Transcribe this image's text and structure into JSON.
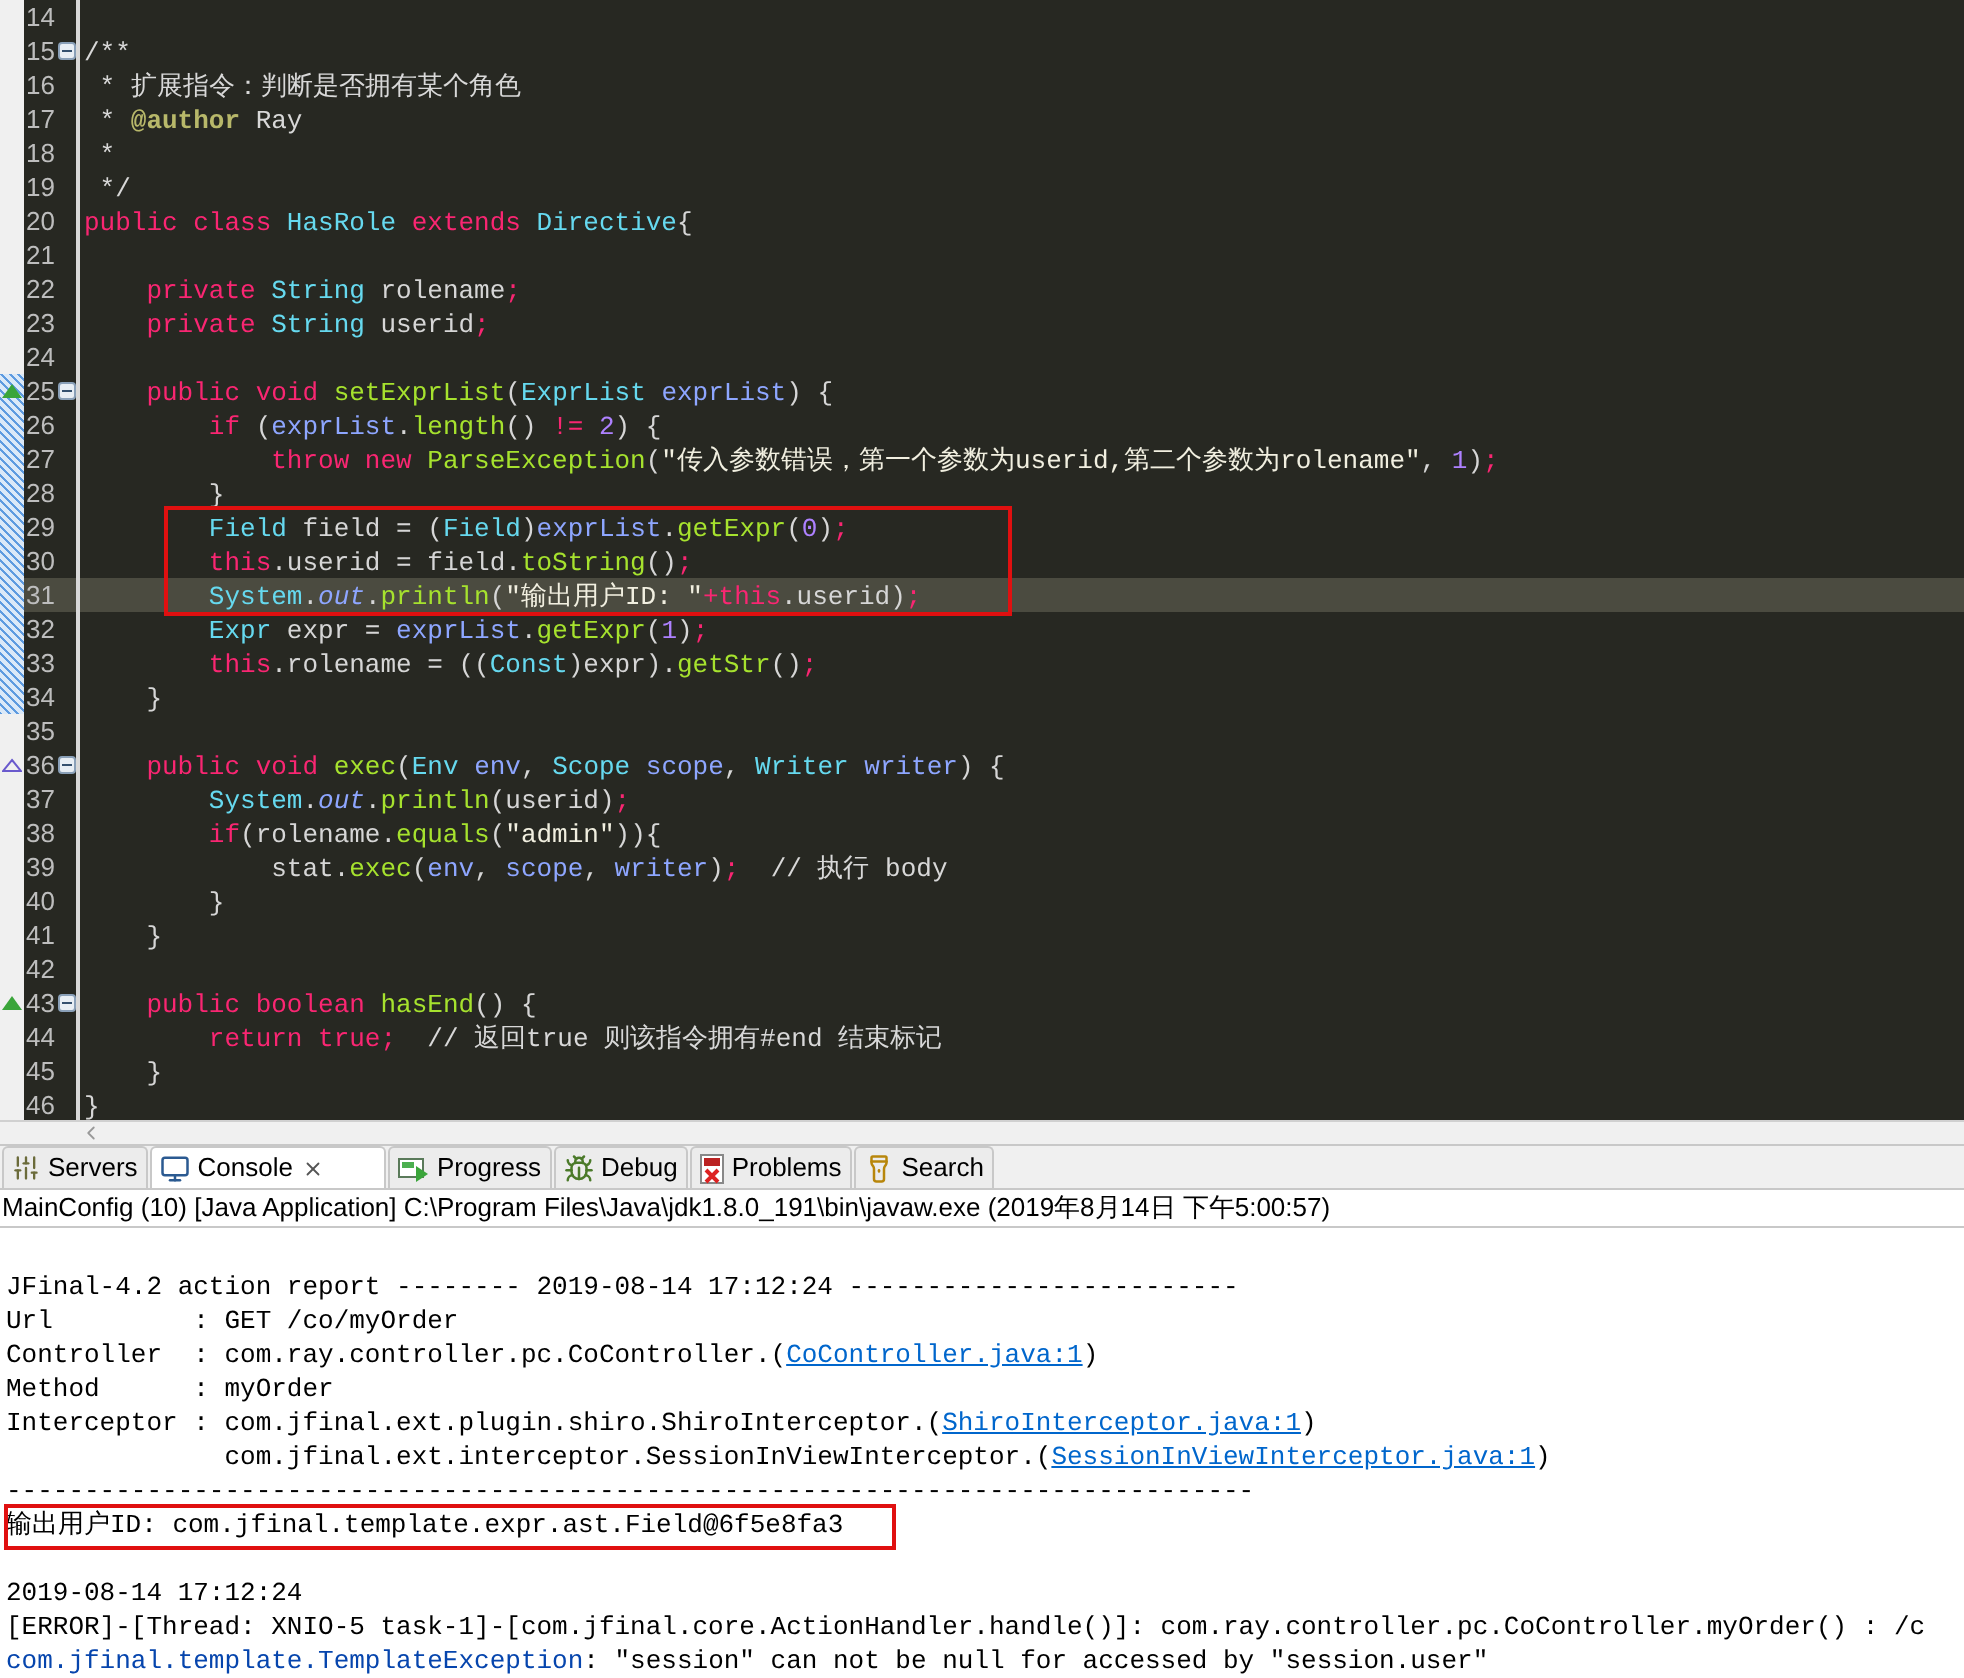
{
  "editor": {
    "lines": [
      {
        "number": "14",
        "current": false,
        "boxed": false,
        "marked": false,
        "fold": false
      },
      {
        "number": "15",
        "tokens": [
          {
            "kind": "comment",
            "text": "/**"
          }
        ],
        "current": false,
        "boxed": false,
        "marked": false,
        "fold": true
      },
      {
        "number": "16",
        "tokens": [
          {
            "kind": "comment",
            "text": " * 扩展指令：判断是否拥有某个角色"
          }
        ],
        "current": false,
        "boxed": false,
        "marked": false,
        "fold": false
      },
      {
        "number": "17",
        "tokens": [
          {
            "kind": "comment",
            "text": " * "
          },
          {
            "kind": "tag",
            "text": "@author"
          },
          {
            "kind": "comment",
            "text": " Ray"
          }
        ],
        "current": false,
        "boxed": false,
        "marked": false,
        "fold": false
      },
      {
        "number": "18",
        "tokens": [
          {
            "kind": "comment",
            "text": " *"
          }
        ],
        "current": false,
        "boxed": false,
        "marked": false,
        "fold": false
      },
      {
        "number": "19",
        "tokens": [
          {
            "kind": "comment",
            "text": " */"
          }
        ],
        "current": false,
        "boxed": false,
        "marked": false,
        "fold": false
      },
      {
        "number": "20",
        "tokens": [
          {
            "kind": "keyword",
            "text": "public class "
          },
          {
            "kind": "type",
            "text": "HasRole "
          },
          {
            "kind": "keyword",
            "text": "extends "
          },
          {
            "kind": "type",
            "text": "Directive"
          },
          {
            "kind": "plain",
            "text": "{"
          }
        ],
        "current": false,
        "boxed": false,
        "marked": false,
        "fold": false
      },
      {
        "number": "21",
        "current": false,
        "boxed": false,
        "marked": false,
        "fold": false
      },
      {
        "number": "22",
        "tokens": [
          {
            "kind": "keyword",
            "text": "    private "
          },
          {
            "kind": "type",
            "text": "String "
          },
          {
            "kind": "plain",
            "text": "rolename"
          },
          {
            "kind": "punct",
            "text": ";"
          }
        ],
        "current": false,
        "boxed": false,
        "marked": false,
        "fold": false
      },
      {
        "number": "23",
        "tokens": [
          {
            "kind": "keyword",
            "text": "    private "
          },
          {
            "kind": "type",
            "text": "String "
          },
          {
            "kind": "plain",
            "text": "userid"
          },
          {
            "kind": "punct",
            "text": ";"
          }
        ],
        "current": false,
        "boxed": false,
        "marked": false,
        "fold": false
      },
      {
        "number": "24",
        "current": false,
        "boxed": false,
        "marked": false,
        "fold": false
      },
      {
        "number": "25",
        "kind": "override",
        "tokens": [
          {
            "kind": "keyword",
            "text": "    public void "
          },
          {
            "kind": "method",
            "text": "setExprList"
          },
          {
            "kind": "plain",
            "text": "("
          },
          {
            "kind": "type",
            "text": "ExprList "
          },
          {
            "kind": "var",
            "text": "exprList"
          },
          {
            "kind": "plain",
            "text": ") {"
          }
        ],
        "current": false,
        "boxed": false,
        "marked": true,
        "fold": true
      },
      {
        "number": "26",
        "tokens": [
          {
            "kind": "keyword",
            "text": "        if"
          },
          {
            "kind": "plain",
            "text": " ("
          },
          {
            "kind": "var",
            "text": "exprList"
          },
          {
            "kind": "plain",
            "text": "."
          },
          {
            "kind": "method",
            "text": "length"
          },
          {
            "kind": "plain",
            "text": "() "
          },
          {
            "kind": "keyword",
            "text": "!= "
          },
          {
            "kind": "number",
            "text": "2"
          },
          {
            "kind": "plain",
            "text": ") {"
          }
        ],
        "current": false,
        "boxed": false,
        "marked": true,
        "fold": false
      },
      {
        "number": "27",
        "tokens": [
          {
            "kind": "keyword",
            "text": "            throw new "
          },
          {
            "kind": "method",
            "text": "ParseException"
          },
          {
            "kind": "plain",
            "text": "("
          },
          {
            "kind": "string",
            "text": "\"传入参数错误，第一个参数为userid,第二个参数为rolename\""
          },
          {
            "kind": "plain",
            "text": ", "
          },
          {
            "kind": "number",
            "text": "1"
          },
          {
            "kind": "plain",
            "text": ")"
          },
          {
            "kind": "punct",
            "text": ";"
          }
        ],
        "current": false,
        "boxed": false,
        "marked": true,
        "fold": false
      },
      {
        "number": "28",
        "tokens": [
          {
            "kind": "plain",
            "text": "        }"
          }
        ],
        "current": false,
        "boxed": false,
        "marked": true,
        "fold": false
      },
      {
        "number": "29",
        "tokens": [
          {
            "kind": "type",
            "text": "        Field"
          },
          {
            "kind": "plain",
            "text": " field = ("
          },
          {
            "kind": "type",
            "text": "Field"
          },
          {
            "kind": "plain",
            "text": ")"
          },
          {
            "kind": "var",
            "text": "exprList"
          },
          {
            "kind": "plain",
            "text": "."
          },
          {
            "kind": "method",
            "text": "getExpr"
          },
          {
            "kind": "plain",
            "text": "("
          },
          {
            "kind": "number",
            "text": "0"
          },
          {
            "kind": "plain",
            "text": ")"
          },
          {
            "kind": "punct",
            "text": ";"
          }
        ],
        "current": false,
        "boxed": true,
        "marked": true,
        "fold": false
      },
      {
        "number": "30",
        "tokens": [
          {
            "kind": "keyword",
            "text": "        this"
          },
          {
            "kind": "plain",
            "text": ".userid = field."
          },
          {
            "kind": "method",
            "text": "toString"
          },
          {
            "kind": "plain",
            "text": "()"
          },
          {
            "kind": "punct",
            "text": ";"
          }
        ],
        "current": false,
        "boxed": true,
        "marked": true,
        "fold": false
      },
      {
        "number": "31",
        "tokens": [
          {
            "kind": "type",
            "text": "        System"
          },
          {
            "kind": "plain",
            "text": "."
          },
          {
            "kind": "static",
            "text": "out"
          },
          {
            "kind": "plain",
            "text": "."
          },
          {
            "kind": "method",
            "text": "println"
          },
          {
            "kind": "plain",
            "text": "("
          },
          {
            "kind": "string",
            "text": "\"输出用户ID: \""
          },
          {
            "kind": "keyword",
            "text": "+this"
          },
          {
            "kind": "plain",
            "text": ".userid)"
          },
          {
            "kind": "punct",
            "text": ";"
          }
        ],
        "current": true,
        "boxed": true,
        "marked": true,
        "fold": false
      },
      {
        "number": "32",
        "tokens": [
          {
            "kind": "type",
            "text": "        Expr"
          },
          {
            "kind": "plain",
            "text": " expr = "
          },
          {
            "kind": "var",
            "text": "exprList"
          },
          {
            "kind": "plain",
            "text": "."
          },
          {
            "kind": "method",
            "text": "getExpr"
          },
          {
            "kind": "plain",
            "text": "("
          },
          {
            "kind": "number",
            "text": "1"
          },
          {
            "kind": "plain",
            "text": ")"
          },
          {
            "kind": "punct",
            "text": ";"
          }
        ],
        "current": false,
        "boxed": false,
        "marked": true,
        "fold": false
      },
      {
        "number": "33",
        "tokens": [
          {
            "kind": "keyword",
            "text": "        this"
          },
          {
            "kind": "plain",
            "text": ".rolename = (("
          },
          {
            "kind": "type",
            "text": "Const"
          },
          {
            "kind": "plain",
            "text": ")expr)."
          },
          {
            "kind": "method",
            "text": "getStr"
          },
          {
            "kind": "plain",
            "text": "()"
          },
          {
            "kind": "punct",
            "text": ";"
          }
        ],
        "current": false,
        "boxed": false,
        "marked": true,
        "fold": false
      },
      {
        "number": "34",
        "tokens": [
          {
            "kind": "plain",
            "text": "    }"
          }
        ],
        "current": false,
        "boxed": false,
        "marked": true,
        "fold": false
      },
      {
        "number": "35",
        "current": false,
        "boxed": false,
        "marked": false,
        "fold": false
      },
      {
        "number": "36",
        "kind": "implement",
        "tokens": [
          {
            "kind": "keyword",
            "text": "    public void "
          },
          {
            "kind": "method",
            "text": "exec"
          },
          {
            "kind": "plain",
            "text": "("
          },
          {
            "kind": "type",
            "text": "Env "
          },
          {
            "kind": "var",
            "text": "env"
          },
          {
            "kind": "plain",
            "text": ", "
          },
          {
            "kind": "type",
            "text": "Scope "
          },
          {
            "kind": "var",
            "text": "scope"
          },
          {
            "kind": "plain",
            "text": ", "
          },
          {
            "kind": "type",
            "text": "Writer "
          },
          {
            "kind": "var",
            "text": "writer"
          },
          {
            "kind": "plain",
            "text": ") {"
          }
        ],
        "current": false,
        "boxed": false,
        "marked": false,
        "fold": true
      },
      {
        "number": "37",
        "tokens": [
          {
            "kind": "type",
            "text": "        System"
          },
          {
            "kind": "plain",
            "text": "."
          },
          {
            "kind": "static",
            "text": "out"
          },
          {
            "kind": "plain",
            "text": "."
          },
          {
            "kind": "method",
            "text": "println"
          },
          {
            "kind": "plain",
            "text": "(userid)"
          },
          {
            "kind": "punct",
            "text": ";"
          }
        ],
        "current": false,
        "boxed": false,
        "marked": false,
        "fold": false
      },
      {
        "number": "38",
        "tokens": [
          {
            "kind": "keyword",
            "text": "        if"
          },
          {
            "kind": "plain",
            "text": "(rolename."
          },
          {
            "kind": "method",
            "text": "equals"
          },
          {
            "kind": "plain",
            "text": "("
          },
          {
            "kind": "string",
            "text": "\"admin\""
          },
          {
            "kind": "plain",
            "text": ")){"
          }
        ],
        "current": false,
        "boxed": false,
        "marked": false,
        "fold": false
      },
      {
        "number": "39",
        "tokens": [
          {
            "kind": "plain",
            "text": "            stat."
          },
          {
            "kind": "method",
            "text": "exec"
          },
          {
            "kind": "plain",
            "text": "("
          },
          {
            "kind": "var",
            "text": "env"
          },
          {
            "kind": "plain",
            "text": ", "
          },
          {
            "kind": "var",
            "text": "scope"
          },
          {
            "kind": "plain",
            "text": ", "
          },
          {
            "kind": "var",
            "text": "writer"
          },
          {
            "kind": "plain",
            "text": ")"
          },
          {
            "kind": "punct",
            "text": ";"
          },
          {
            "kind": "comment",
            "text": "  // 执行 body"
          }
        ],
        "current": false,
        "boxed": false,
        "marked": false,
        "fold": false
      },
      {
        "number": "40",
        "tokens": [
          {
            "kind": "plain",
            "text": "        }"
          }
        ],
        "current": false,
        "boxed": false,
        "marked": false,
        "fold": false
      },
      {
        "number": "41",
        "tokens": [
          {
            "kind": "plain",
            "text": "    }"
          }
        ],
        "current": false,
        "boxed": false,
        "marked": false,
        "fold": false
      },
      {
        "number": "42",
        "current": false,
        "boxed": false,
        "marked": false,
        "fold": false
      },
      {
        "number": "43",
        "kind": "override",
        "tokens": [
          {
            "kind": "keyword",
            "text": "    public boolean "
          },
          {
            "kind": "method",
            "text": "hasEnd"
          },
          {
            "kind": "plain",
            "text": "() {"
          }
        ],
        "current": false,
        "boxed": false,
        "marked": false,
        "fold": true
      },
      {
        "number": "44",
        "tokens": [
          {
            "kind": "keyword",
            "text": "        return true"
          },
          {
            "kind": "punct",
            "text": ";"
          },
          {
            "kind": "comment",
            "text": "  // 返回true 则该指令拥有#end 结束标记"
          }
        ],
        "current": false,
        "boxed": false,
        "marked": false,
        "fold": false
      },
      {
        "number": "45",
        "tokens": [
          {
            "kind": "plain",
            "text": "    }"
          }
        ],
        "current": false,
        "boxed": false,
        "marked": false,
        "fold": false
      },
      {
        "number": "46",
        "tokens": [
          {
            "kind": "plain",
            "text": "}"
          }
        ],
        "current": false,
        "boxed": false,
        "marked": false,
        "fold": false
      }
    ]
  },
  "tabs": [
    {
      "kind": "servers",
      "label": "Servers",
      "selected": false
    },
    {
      "kind": "console",
      "label": "Console",
      "selected": true
    },
    {
      "kind": "progress",
      "label": "Progress",
      "selected": false
    },
    {
      "kind": "debug",
      "label": "Debug",
      "selected": false
    },
    {
      "kind": "problems",
      "label": "Problems",
      "selected": false
    },
    {
      "kind": "search",
      "label": "Search",
      "selected": false
    }
  ],
  "console": {
    "status": "MainConfig (10) [Java Application] C:\\Program Files\\Java\\jdk1.8.0_191\\bin\\javaw.exe (2019年8月14日 下午5:00:57)",
    "lines": [
      {
        "spaced": true,
        "boxed": false,
        "segments": [
          {
            "kind": "text",
            "text": "JFinal-4.2 action report -------- 2019-08-14 17:12:24 -------------------------"
          }
        ]
      },
      {
        "spaced": false,
        "boxed": false,
        "segments": [
          {
            "kind": "text",
            "text": "Url         : GET /co/myOrder"
          }
        ]
      },
      {
        "spaced": false,
        "boxed": false,
        "segments": [
          {
            "kind": "text",
            "text": "Controller  : com.ray.controller.pc.CoController.("
          },
          {
            "kind": "link",
            "text": "CoController.java:1"
          },
          {
            "kind": "text",
            "text": ")"
          }
        ]
      },
      {
        "spaced": false,
        "boxed": false,
        "segments": [
          {
            "kind": "text",
            "text": "Method      : myOrder"
          }
        ]
      },
      {
        "spaced": false,
        "boxed": false,
        "segments": [
          {
            "kind": "text",
            "text": "Interceptor : com.jfinal.ext.plugin.shiro.ShiroInterceptor.("
          },
          {
            "kind": "link",
            "text": "ShiroInterceptor.java:1"
          },
          {
            "kind": "text",
            "text": ")"
          }
        ]
      },
      {
        "spaced": false,
        "boxed": false,
        "segments": [
          {
            "kind": "text",
            "text": "              com.jfinal.ext.interceptor.SessionInViewInterceptor.("
          },
          {
            "kind": "link",
            "text": "SessionInViewInterceptor.java:1"
          },
          {
            "kind": "text",
            "text": ")"
          }
        ]
      },
      {
        "spaced": false,
        "boxed": false,
        "segments": [
          {
            "kind": "text",
            "text": "--------------------------------------------------------------------------------"
          }
        ]
      },
      {
        "spaced": false,
        "boxed": true,
        "segments": [
          {
            "kind": "text",
            "text": "输出用户ID: com.jfinal.template.expr.ast.Field@6f5e8fa3"
          }
        ]
      },
      {
        "spaced": true,
        "boxed": false,
        "segments": [
          {
            "kind": "text",
            "text": "2019-08-14 17:12:24"
          }
        ]
      },
      {
        "spaced": false,
        "boxed": false,
        "segments": [
          {
            "kind": "text",
            "text": "[ERROR]-[Thread: XNIO-5 task-1]-[com.jfinal.core.ActionHandler.handle()]: com.ray.controller.pc.CoController.myOrder() : /c"
          }
        ]
      },
      {
        "spaced": false,
        "boxed": false,
        "segments": [
          {
            "kind": "class",
            "text": "com.jfinal.template.TemplateException"
          },
          {
            "kind": "text",
            "text": ": \"session\" can not be null for accessed by \"session.user\""
          }
        ]
      }
    ]
  }
}
